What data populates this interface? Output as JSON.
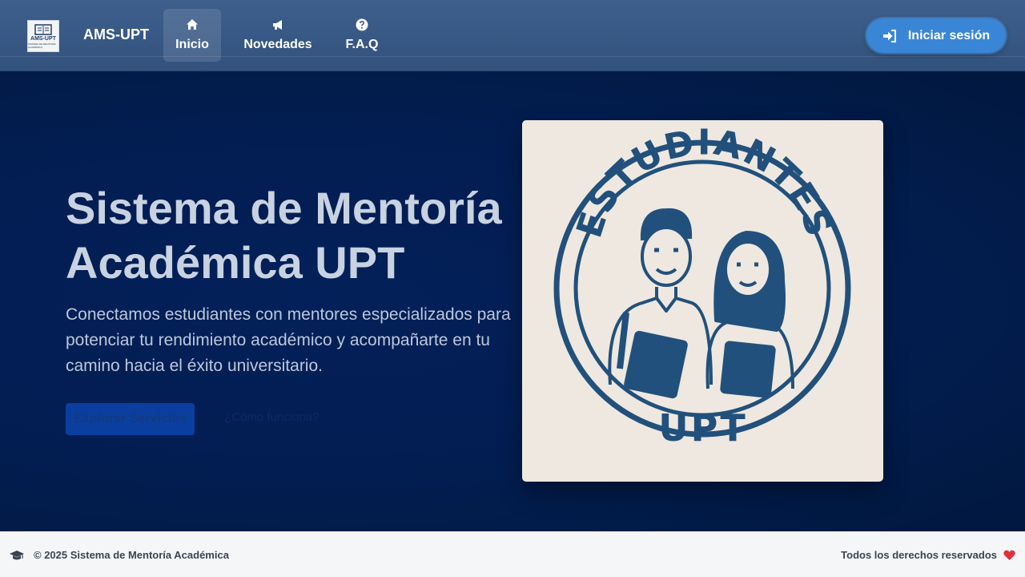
{
  "header": {
    "logo_text": "AMS-UPT",
    "logo_sub": "SISTEMA DE MENTORÍA ACADÉMICA",
    "brand": "AMS-UPT",
    "nav": [
      {
        "label": "Inicio",
        "icon": "home-icon",
        "active": true
      },
      {
        "label": "Novedades",
        "icon": "bullhorn-icon",
        "active": false
      },
      {
        "label": "F.A.Q",
        "icon": "question-circle-icon",
        "active": false
      }
    ],
    "login_label": "Iniciar sesión",
    "login_icon": "sign-in-icon",
    "colors": {
      "nav_bg": "#3e5f8c",
      "login_bg": "#3a86d6"
    }
  },
  "hero": {
    "title": "Sistema de Mentoría Académica UPT",
    "description": "Conectamos estudiantes con mentores especializados para potenciar tu rendimiento académico y acompañarte en tu camino hacia el éxito universitario.",
    "primary_button": "Explorar Servicios",
    "secondary_link": "¿Cómo funciona?",
    "image": {
      "top_text": "ESTUDIANTES",
      "bottom_text": "UPT"
    },
    "colors": {
      "bg": "#021f4d",
      "accent": "#0a3fa0"
    }
  },
  "footer": {
    "copyright": "© 2025 Sistema de Mentoría Académica",
    "rights": "Todos los derechos reservados",
    "left_icon": "graduation-cap-icon",
    "right_icon": "heart-icon",
    "heart_color": "#e0303a"
  }
}
